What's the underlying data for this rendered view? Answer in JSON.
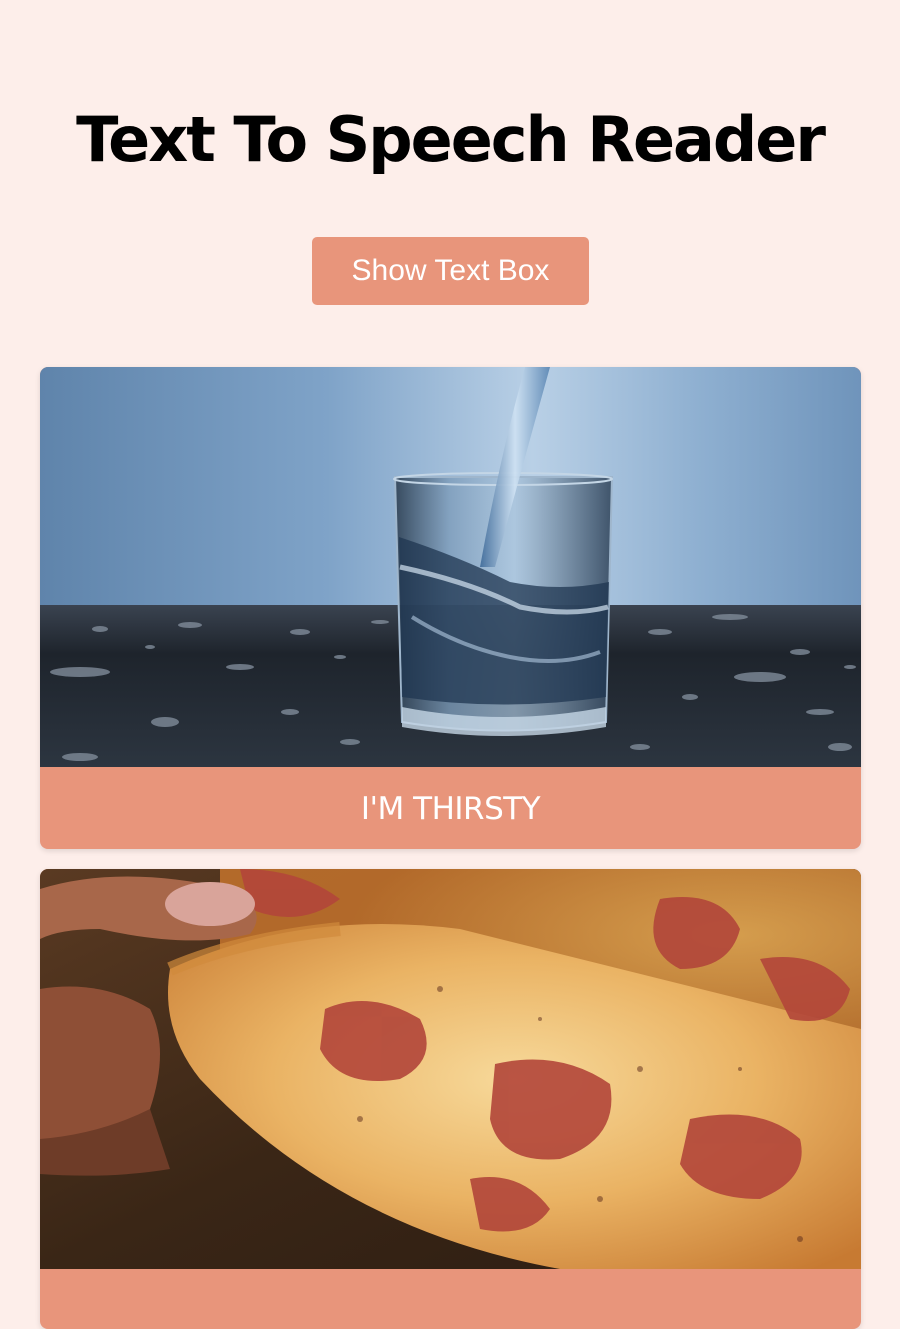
{
  "header": {
    "title": "Text To Speech Reader"
  },
  "controls": {
    "toggle_label": "Show Text Box"
  },
  "cards": [
    {
      "label": "I'M THIRSTY",
      "image": "glass-of-water-image"
    },
    {
      "label": "",
      "image": "pizza-slice-image"
    }
  ],
  "colors": {
    "background": "#fdeeea",
    "accent": "#e8957b",
    "title": "#000000",
    "label_text": "#ffffff"
  }
}
